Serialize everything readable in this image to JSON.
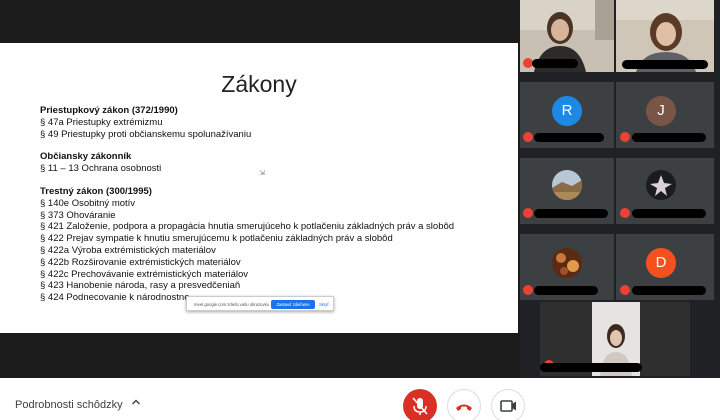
{
  "slide": {
    "title": "Zákony",
    "sections": [
      {
        "heading": "Priestupkový zákon (372/1990)",
        "items": [
          "§ 47a Priestupky extrémizmu",
          "§ 49 Priestupky proti občianskemu spolunažívaniu"
        ]
      },
      {
        "heading": "Občiansky zákonník",
        "items": [
          "§ 11 – 13 Ochrana osobnosti"
        ]
      },
      {
        "heading": "Trestný zákon (300/1995)",
        "items": [
          "§ 140e Osobitný motív",
          "§ 373 Ohováranie",
          "§ 421 Založenie, podpora a propagácia hnutia smerujúceho k potlačeniu základných práv a slobôd",
          "§ 422 Prejav sympatie k hnutiu smerujúcemu k potlačeniu základných práv a slobôd",
          "§ 422a Výroba extrémistických materiálov",
          "§ 422b Rozširovanie extrémistických materiálov",
          "§ 422c Prechovávanie extrémistických materiálov",
          "§ 423 Hanobenie národa, rasy a presvedčeniaň",
          "§ 424 Podnecovanie k národnostne"
        ]
      }
    ]
  },
  "share_bar": {
    "text": "meet.google.com zdieľa vašu obrazovku",
    "stop_label": "Zastaviť zdieľanie",
    "hide_label": "Skryť"
  },
  "participants": [
    {
      "initial": "R",
      "color": "#1e88e5"
    },
    {
      "initial": "J",
      "color": "#795548"
    },
    {
      "initial": "D",
      "color": "#f4511e"
    }
  ],
  "bottom_bar": {
    "details_label": "Podrobnosti schôdzky",
    "chevron": "^"
  },
  "colors": {
    "mute_red": "#ea4335",
    "mic_off_button": "#d93025",
    "hangup_red": "#d93025",
    "share_blue": "#1a73e8"
  },
  "icons": {
    "mic": "mic-off-icon",
    "hangup": "phone-hangup-icon",
    "camera": "camera-icon",
    "chevron": "chevron-up-icon"
  }
}
